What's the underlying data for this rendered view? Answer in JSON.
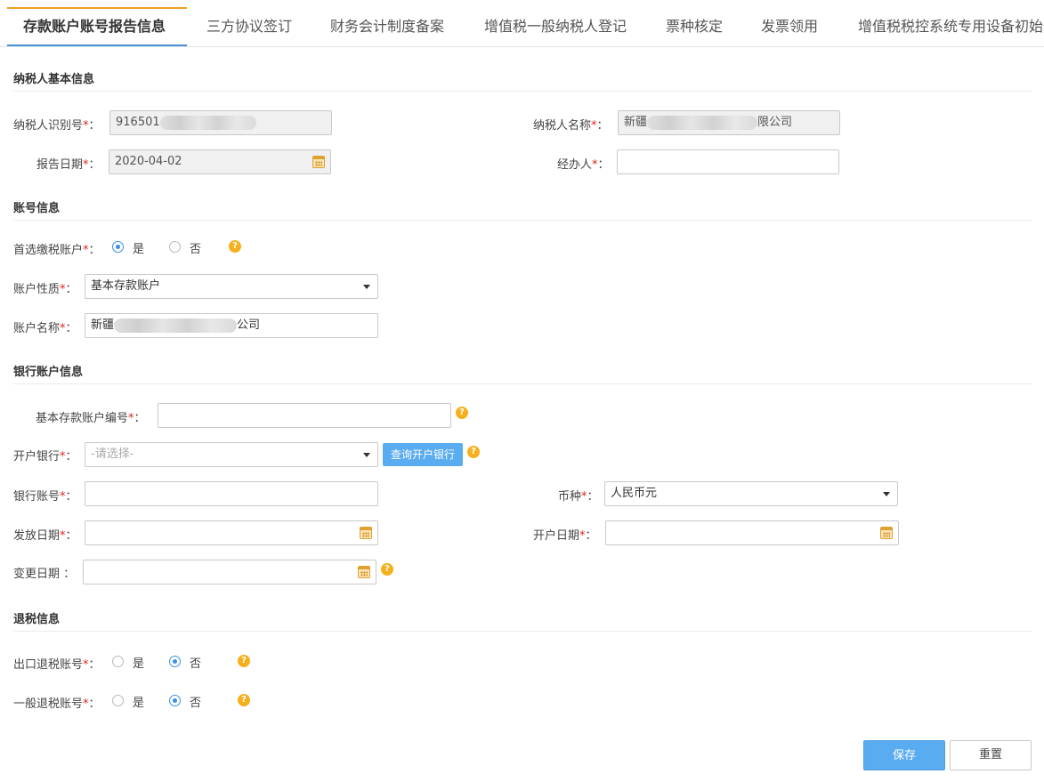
{
  "tabs": [
    {
      "label": "存款账户账号报告信息",
      "active": true
    },
    {
      "label": "三方协议签订"
    },
    {
      "label": "财务会计制度备案"
    },
    {
      "label": "增值税一般纳税人登记"
    },
    {
      "label": "票种核定"
    },
    {
      "label": "发票领用"
    },
    {
      "label": "增值税税控系统专用设备初始"
    }
  ],
  "taxpayer_section": {
    "title": "纳税人基本信息",
    "taxpayer_id_label": "纳税人识别号",
    "taxpayer_id_value": "916501",
    "taxpayer_name_label": "纳税人名称",
    "taxpayer_name_prefix": "新疆",
    "taxpayer_name_suffix": "限公司",
    "report_date_label": "报告日期",
    "report_date_value": "2020-04-02",
    "handler_label": "经办人",
    "handler_value": ""
  },
  "account_section": {
    "title": "账号信息",
    "preferred_label": "首选缴税账户",
    "yes": "是",
    "no": "否",
    "preferred_selected": "yes",
    "nature_label": "账户性质",
    "nature_value": "基本存款账户",
    "name_label": "账户名称",
    "name_prefix": "新疆",
    "name_suffix": "公司"
  },
  "bank_section": {
    "title": "银行账户信息",
    "basic_no_label": "基本存款账户编号",
    "bank_label": "开户银行",
    "bank_placeholder": "-请选择-",
    "query_button": "查询开户银行",
    "account_no_label": "银行账号",
    "currency_label": "币种",
    "currency_value": "人民币元",
    "issue_date_label": "发放日期",
    "open_date_label": "开户日期",
    "change_date_label": "变更日期"
  },
  "refund_section": {
    "title": "退税信息",
    "export_label": "出口退税账号",
    "general_label": "一般退税账号",
    "yes": "是",
    "no": "否"
  },
  "actions": {
    "save": "保存",
    "reset": "重置"
  },
  "required_mark": "*",
  "colon": "："
}
